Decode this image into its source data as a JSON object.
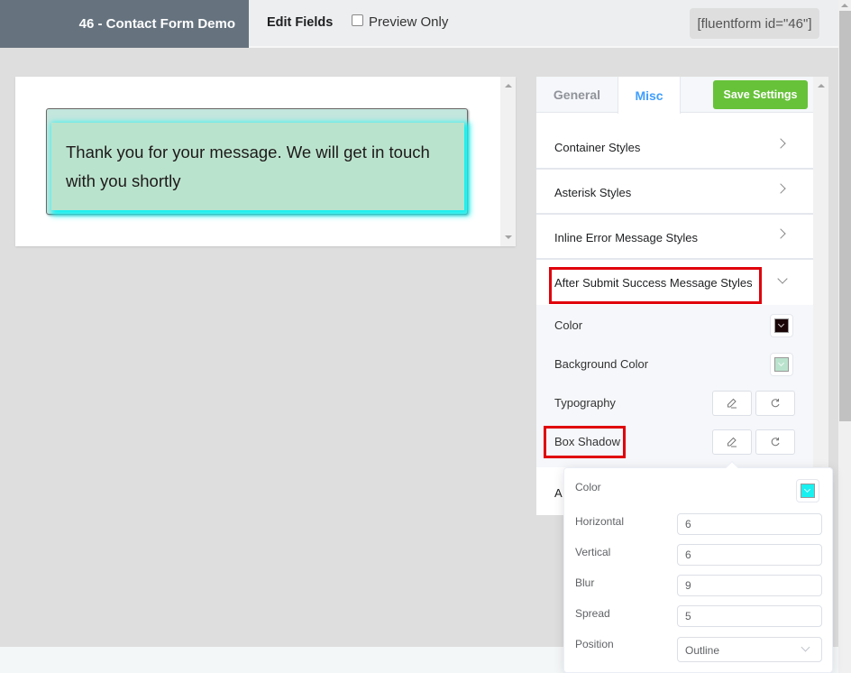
{
  "header": {
    "form_title": "46 - Contact Form Demo",
    "edit_fields": "Edit Fields",
    "preview_only_label": "Preview Only",
    "preview_only_checked": false,
    "shortcode": "[fluentform id=\"46\"]"
  },
  "preview": {
    "success_message": "Thank you for your message. We will get in touch with you shortly"
  },
  "settings": {
    "tabs": [
      {
        "label": "General",
        "active": false
      },
      {
        "label": "Misc",
        "active": true
      }
    ],
    "save_button": "Save Settings",
    "sections": [
      {
        "label": "Container Styles",
        "expanded": false
      },
      {
        "label": "Asterisk Styles",
        "expanded": false
      },
      {
        "label": "Inline Error Message Styles",
        "expanded": false
      },
      {
        "label": "After Submit Success Message Styles",
        "expanded": true
      },
      {
        "label": "A",
        "expanded": false
      }
    ],
    "success_styles": {
      "color_label": "Color",
      "color_value": "#1a0608",
      "background_color_label": "Background Color",
      "background_color_value": "#bae3cd",
      "typography_label": "Typography",
      "box_shadow_label": "Box Shadow"
    }
  },
  "box_shadow_popover": {
    "color_label": "Color",
    "color_value": "#19f0f0",
    "horizontal_label": "Horizontal",
    "horizontal_value": "6",
    "vertical_label": "Vertical",
    "vertical_value": "6",
    "blur_label": "Blur",
    "blur_value": "9",
    "spread_label": "Spread",
    "spread_value": "5",
    "position_label": "Position",
    "position_value": "Outline"
  },
  "icons": {
    "edit": "pencil-icon",
    "reset": "refresh-icon"
  }
}
